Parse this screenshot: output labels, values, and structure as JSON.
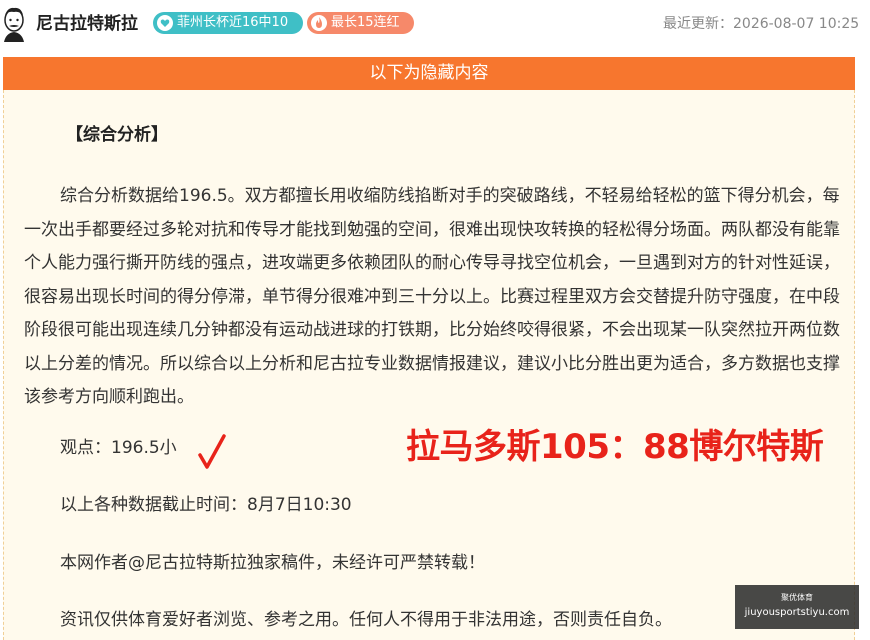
{
  "header": {
    "author": "尼古拉特斯拉",
    "badges": [
      {
        "label": "菲州长杯近16中10",
        "color": "#3fbfc6",
        "icon": "heart-icon"
      },
      {
        "label": "最长15连红",
        "color": "#f6896a",
        "icon": "flame-icon"
      }
    ],
    "updated": "最近更新：2026-08-07 10:25"
  },
  "banner": {
    "text": "以下为隐藏内容"
  },
  "article": {
    "heading": "【综合分析】",
    "body": "综合分析数据给196.5。双方都擅长用收缩防线掐断对手的突破路线，不轻易给轻松的篮下得分机会，每一次出手都要经过多轮对抗和传导才能找到勉强的空间，很难出现快攻转换的轻松得分场面。两队都没有能靠个人能力强行撕开防线的强点，进攻端更多依赖团队的耐心传导寻找空位机会，一旦遇到对方的针对性延误，很容易出现长时间的得分停滞，单节得分很难冲到三十分以上。比赛过程里双方会交替提升防守强度，在中段阶段很可能出现连续几分钟都没有运动战进球的打铁期，比分始终咬得很紧，不会出现某一队突然拉开两位数以上分差的情况。所以综合以上分析和尼古拉专业数据情报建议，建议小比分胜出更为适合，多方数据也支撑该参考方向顺利跑出。",
    "viewpoint": "观点：196.5小",
    "result": "拉马多斯105：88博尔特斯",
    "cutoff": "以上各种数据截止时间：8月7日10:30",
    "copyright": "本网作者@尼古拉特斯拉独家稿件，未经许可严禁转载！",
    "disclaimer": "资讯仅供体育爱好者浏览、参考之用。任何人不得用于非法用途，否则责任自负。"
  },
  "watermark": {
    "top": "聚优体育",
    "site": "jiuyousportstiyu.com"
  },
  "colors": {
    "accent": "#f7762e",
    "result_red": "#e8231a",
    "content_bg": "#fffaed"
  }
}
